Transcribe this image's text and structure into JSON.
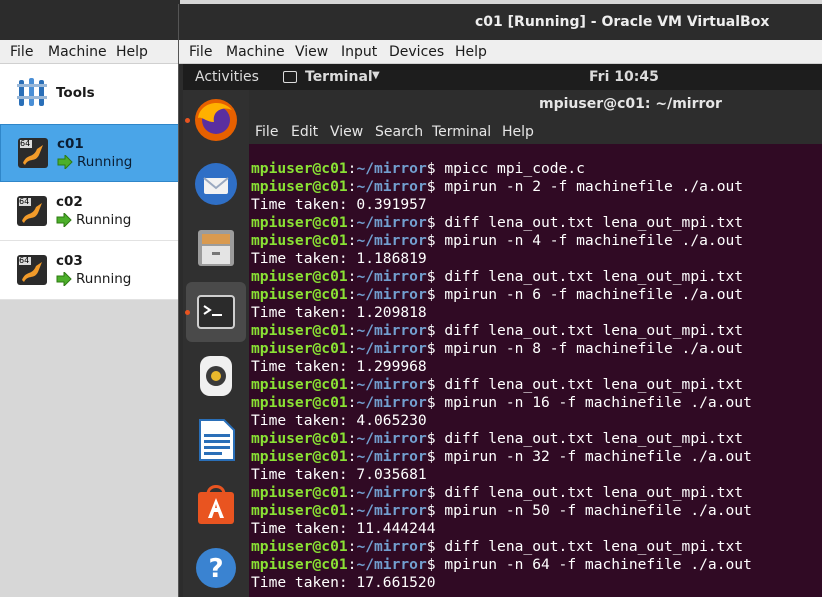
{
  "manager": {
    "menu": [
      "File",
      "Machine",
      "Help"
    ],
    "tools_label": "Tools",
    "vms": [
      {
        "name": "c01",
        "state": "Running",
        "selected": true,
        "badge": "64"
      },
      {
        "name": "c02",
        "state": "Running",
        "selected": false,
        "badge": "64"
      },
      {
        "name": "c03",
        "state": "Running",
        "selected": false,
        "badge": "64"
      }
    ]
  },
  "vm_window": {
    "title": "c01 [Running] - Oracle VM VirtualBox",
    "menu": [
      "File",
      "Machine",
      "View",
      "Input",
      "Devices",
      "Help"
    ]
  },
  "ubuntu": {
    "activities": "Activities",
    "app_menu": "Terminal",
    "clock": "Fri 10:45",
    "dock": [
      "firefox-icon",
      "thunderbird-icon",
      "files-icon",
      "terminal-icon",
      "rhythmbox-icon",
      "libreoffice-writer-icon",
      "software-center-icon",
      "help-icon"
    ]
  },
  "terminal": {
    "title": "mpiuser@c01: ~/mirror",
    "menu": [
      "File",
      "Edit",
      "View",
      "Search",
      "Terminal",
      "Help"
    ],
    "prompt_user": "mpiuser@c01",
    "prompt_path": "~/mirror",
    "lines": [
      {
        "type": "cmd",
        "text": " mpicc mpi_code.c"
      },
      {
        "type": "cmd",
        "text": " mpirun -n 2 -f machinefile ./a.out"
      },
      {
        "type": "out",
        "text": "Time taken: 0.391957"
      },
      {
        "type": "cmd",
        "text": " diff lena_out.txt lena_out_mpi.txt"
      },
      {
        "type": "cmd",
        "text": " mpirun -n 4 -f machinefile ./a.out"
      },
      {
        "type": "out",
        "text": "Time taken: 1.186819"
      },
      {
        "type": "cmd",
        "text": " diff lena_out.txt lena_out_mpi.txt"
      },
      {
        "type": "cmd",
        "text": " mpirun -n 6 -f machinefile ./a.out"
      },
      {
        "type": "out",
        "text": "Time taken: 1.209818"
      },
      {
        "type": "cmd",
        "text": " diff lena_out.txt lena_out_mpi.txt"
      },
      {
        "type": "cmd",
        "text": " mpirun -n 8 -f machinefile ./a.out"
      },
      {
        "type": "out",
        "text": "Time taken: 1.299968"
      },
      {
        "type": "cmd",
        "text": " diff lena_out.txt lena_out_mpi.txt"
      },
      {
        "type": "cmd",
        "text": " mpirun -n 16 -f machinefile ./a.out"
      },
      {
        "type": "out",
        "text": "Time taken: 4.065230"
      },
      {
        "type": "cmd",
        "text": " diff lena_out.txt lena_out_mpi.txt"
      },
      {
        "type": "cmd",
        "text": " mpirun -n 32 -f machinefile ./a.out"
      },
      {
        "type": "out",
        "text": "Time taken: 7.035681"
      },
      {
        "type": "cmd",
        "text": " diff lena_out.txt lena_out_mpi.txt"
      },
      {
        "type": "cmd",
        "text": " mpirun -n 50 -f machinefile ./a.out"
      },
      {
        "type": "out",
        "text": "Time taken: 11.444244"
      },
      {
        "type": "cmd",
        "text": " diff lena_out.txt lena_out_mpi.txt"
      },
      {
        "type": "cmd",
        "text": " mpirun -n 64 -f machinefile ./a.out"
      },
      {
        "type": "out",
        "text": "Time taken: 17.661520"
      }
    ]
  },
  "colors": {
    "terminal_bg": "#300a24",
    "prompt_user": "#8ae234",
    "prompt_path": "#729fcf",
    "selection": "#4aa5e8",
    "ubuntu_orange": "#e95420"
  }
}
